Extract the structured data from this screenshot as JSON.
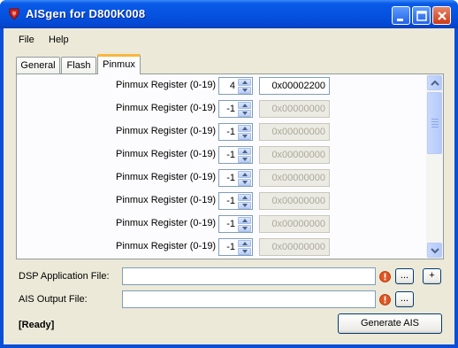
{
  "window": {
    "title": "AISgen for D800K008"
  },
  "menu": {
    "file": "File",
    "help": "Help"
  },
  "tabs": {
    "general": "General",
    "flash": "Flash",
    "pinmux": "Pinmux"
  },
  "pinmux": {
    "rows": [
      {
        "label": "Pinmux Register (0-19)",
        "index": "4",
        "value": "0x00002200",
        "enabled": true
      },
      {
        "label": "Pinmux Register (0-19)",
        "index": "-1",
        "value": "0x00000000",
        "enabled": false
      },
      {
        "label": "Pinmux Register (0-19)",
        "index": "-1",
        "value": "0x00000000",
        "enabled": false
      },
      {
        "label": "Pinmux Register (0-19)",
        "index": "-1",
        "value": "0x00000000",
        "enabled": false
      },
      {
        "label": "Pinmux Register (0-19)",
        "index": "-1",
        "value": "0x00000000",
        "enabled": false
      },
      {
        "label": "Pinmux Register (0-19)",
        "index": "-1",
        "value": "0x00000000",
        "enabled": false
      },
      {
        "label": "Pinmux Register (0-19)",
        "index": "-1",
        "value": "0x00000000",
        "enabled": false
      },
      {
        "label": "Pinmux Register (0-19)",
        "index": "-1",
        "value": "0x00000000",
        "enabled": false
      }
    ]
  },
  "files": {
    "dsp_label": "DSP Application File:",
    "dsp_value": "",
    "ais_label": "AIS Output File:",
    "ais_value": "",
    "browse_label": "...",
    "add_label": "+"
  },
  "status": {
    "text": "[Ready]"
  },
  "actions": {
    "generate_label": "Generate AIS"
  },
  "colors": {
    "error_icon": "#e2551f",
    "accent_tab": "#f9b740",
    "titlebar": "#0553e0"
  }
}
